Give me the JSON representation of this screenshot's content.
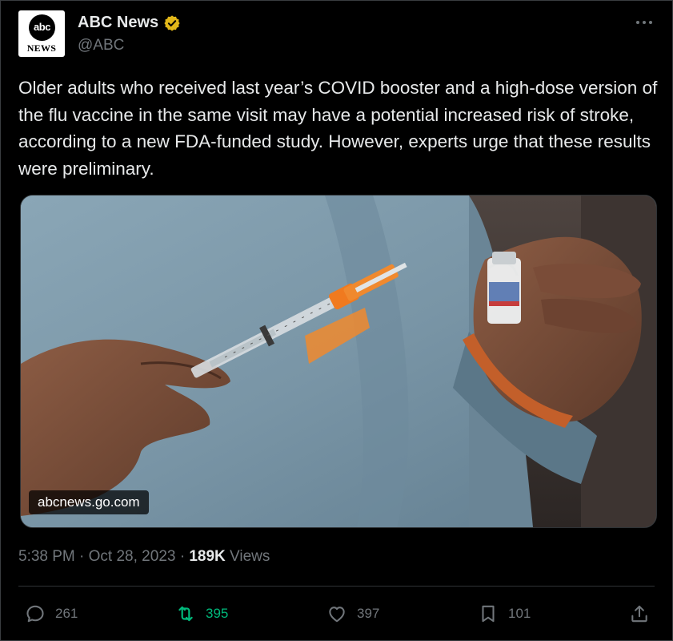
{
  "author": {
    "avatar_text_top": "abc",
    "avatar_text_bottom": "NEWS",
    "display_name": "ABC News",
    "handle": "@ABC",
    "verified_badge_icon": "verified-badge-gold",
    "more_icon": "more-horizontal"
  },
  "tweet": {
    "text": "Older adults who received last year’s COVID booster and a high-dose version of the flu vaccine in the same visit may have a potential increased risk of stroke, according to a new FDA-funded study. However, experts urge that these results were preliminary."
  },
  "media": {
    "source_label": "abcnews.go.com"
  },
  "meta": {
    "time": "5:38 PM",
    "separator": "·",
    "date": "Oct 28, 2023",
    "views_count": "189K",
    "views_label": "Views"
  },
  "actions": {
    "reply": {
      "icon": "reply-icon",
      "count": "261"
    },
    "retweet": {
      "icon": "retweet-icon",
      "count": "395",
      "color": "#00ba7c"
    },
    "like": {
      "icon": "heart-icon",
      "count": "397"
    },
    "bookmark": {
      "icon": "bookmark-icon",
      "count": "101"
    },
    "share": {
      "icon": "share-icon"
    }
  },
  "colors": {
    "background": "#000000",
    "text_primary": "#e7e9ea",
    "text_secondary": "#71767b",
    "verified_gold": "#e2b719",
    "retweet_green": "#00ba7c"
  }
}
